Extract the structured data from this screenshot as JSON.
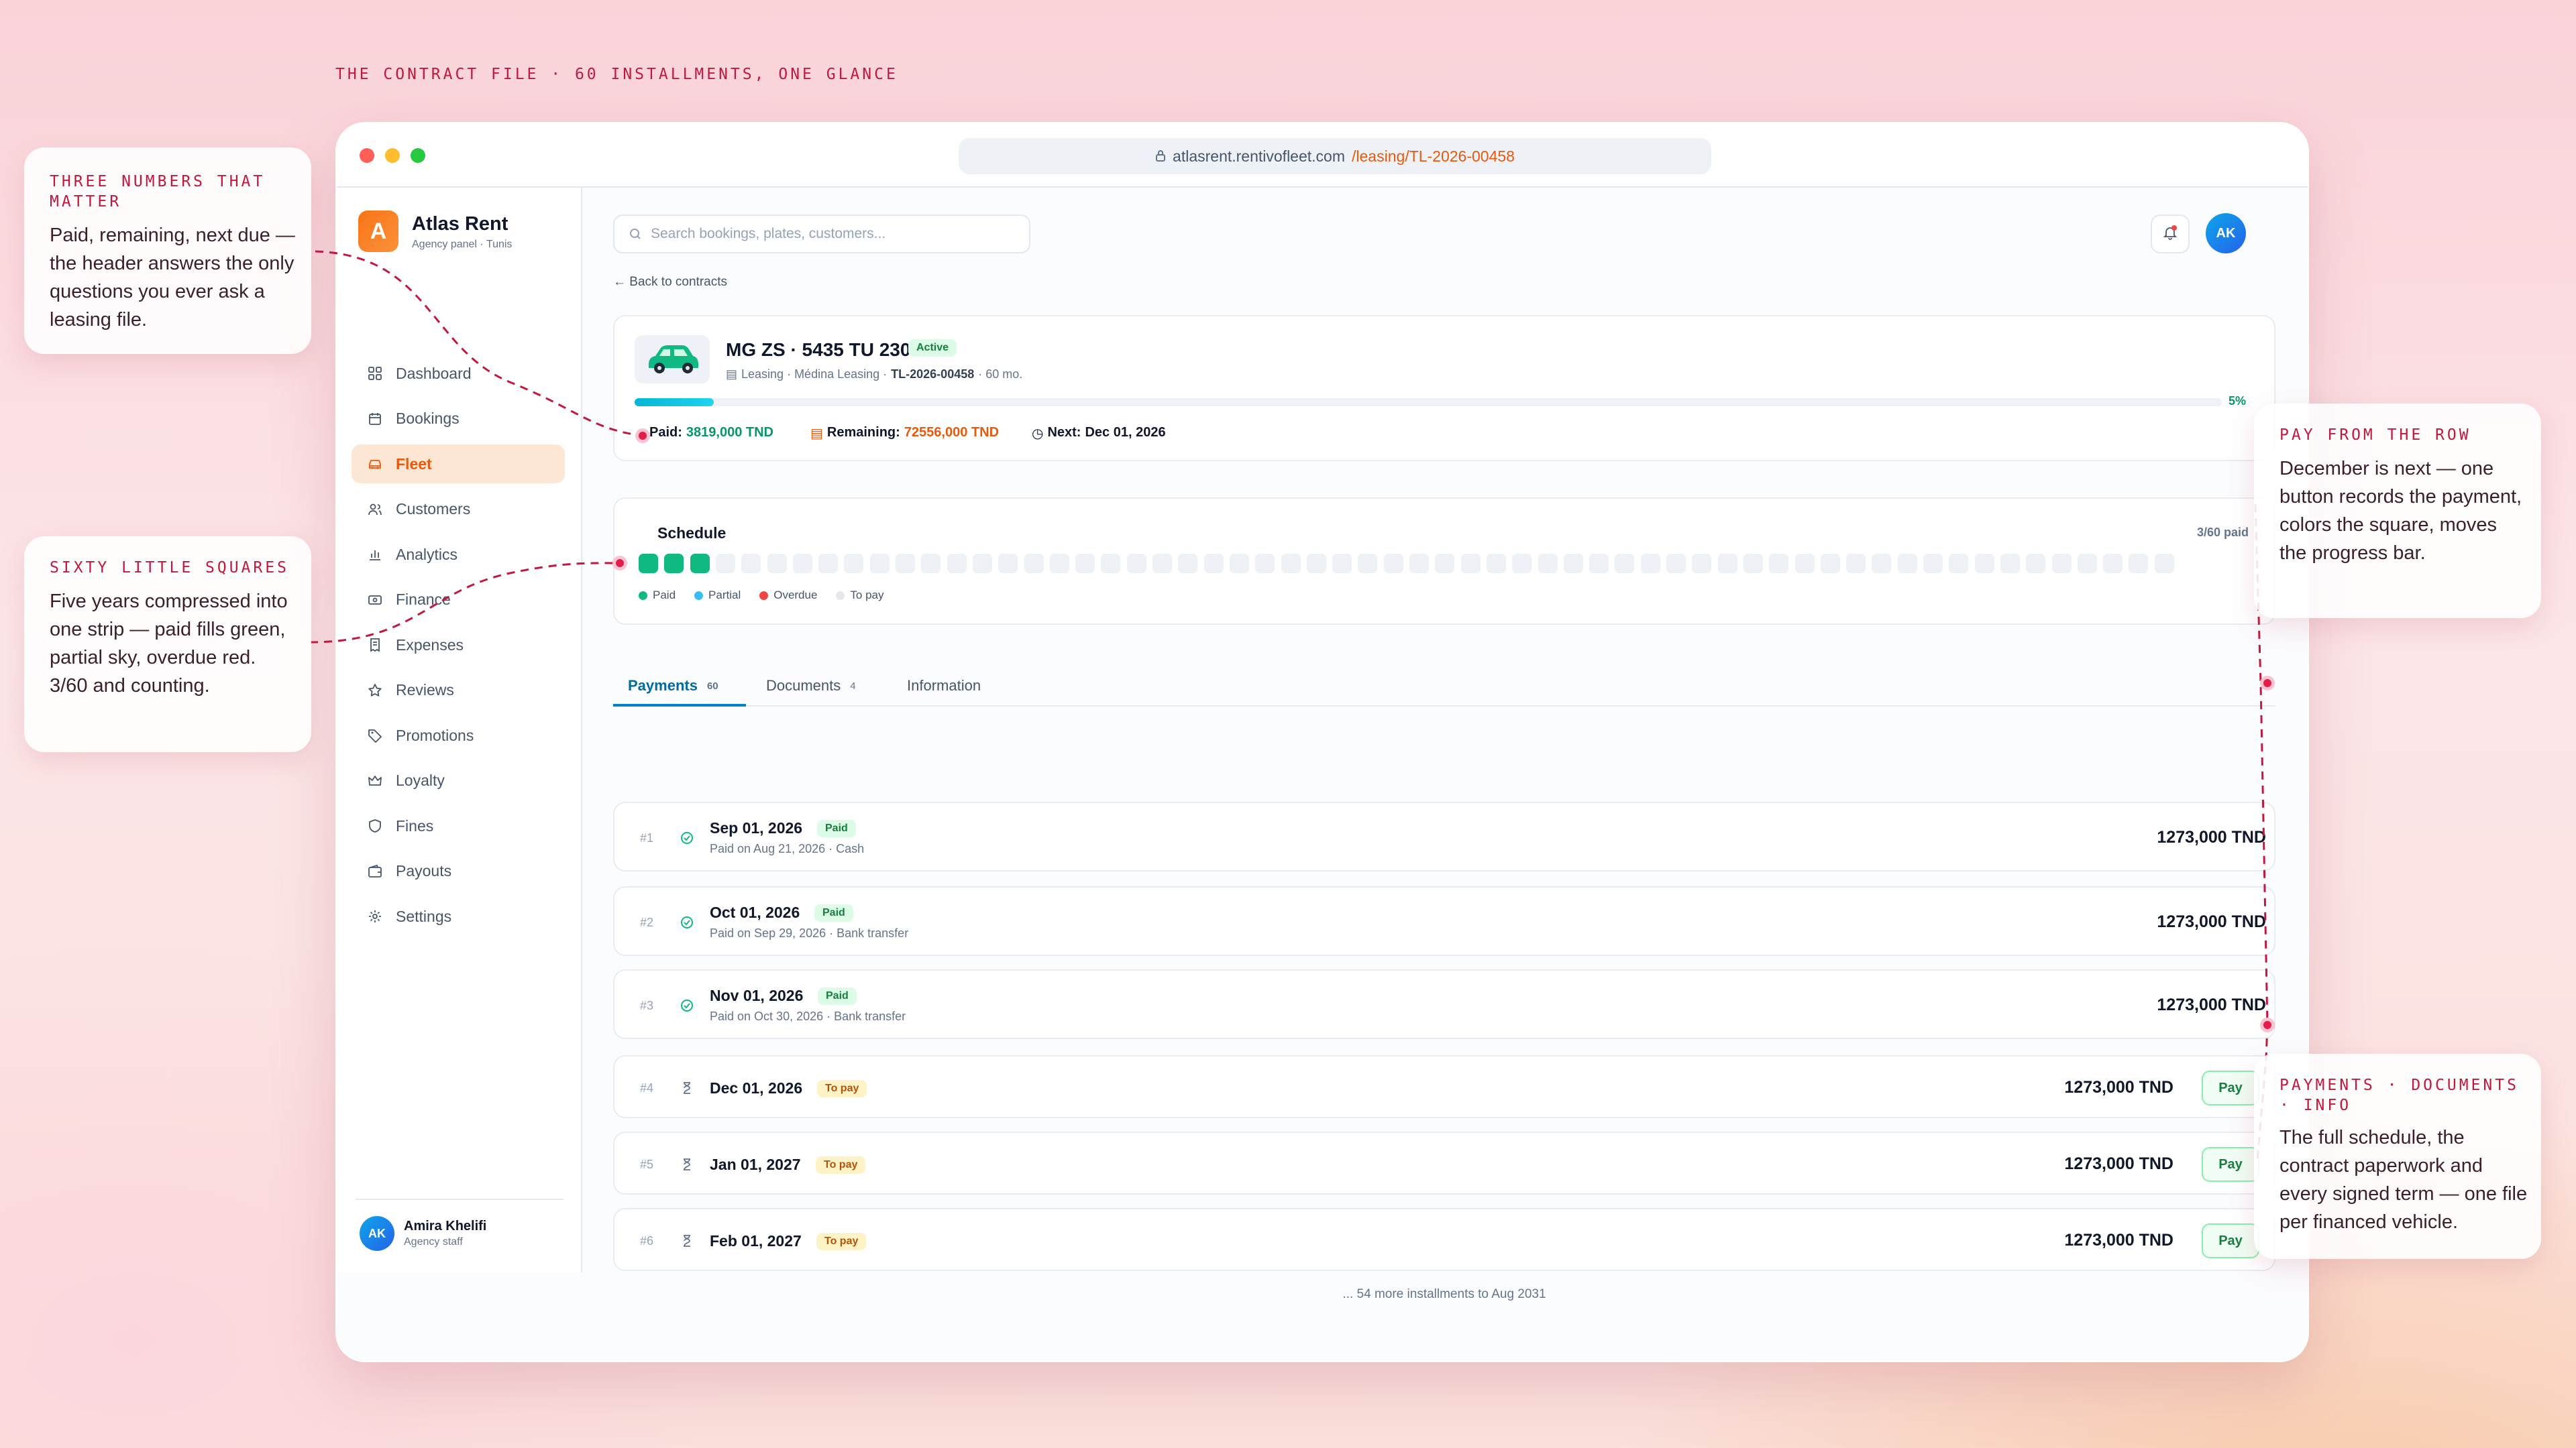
{
  "tagline": "THE CONTRACT FILE · 60 INSTALLMENTS, ONE GLANCE",
  "browser": {
    "host": "atlasrent.rentivofleet.com",
    "path": "/leasing/TL-2026-00458"
  },
  "sidebar": {
    "logo": "A",
    "brand": "Atlas Rent",
    "sub": "Agency panel · Tunis",
    "items": [
      {
        "label": "Dashboard",
        "icon": "grid-icon"
      },
      {
        "label": "Bookings",
        "icon": "calendar-icon"
      },
      {
        "label": "Fleet",
        "icon": "car-icon"
      },
      {
        "label": "Customers",
        "icon": "users-icon"
      },
      {
        "label": "Analytics",
        "icon": "bar-chart-icon"
      },
      {
        "label": "Finance",
        "icon": "banknote-icon"
      },
      {
        "label": "Expenses",
        "icon": "receipt-icon"
      },
      {
        "label": "Reviews",
        "icon": "star-icon"
      },
      {
        "label": "Promotions",
        "icon": "tag-icon"
      },
      {
        "label": "Loyalty",
        "icon": "crown-icon"
      },
      {
        "label": "Fines",
        "icon": "shield-icon"
      },
      {
        "label": "Payouts",
        "icon": "wallet-icon"
      },
      {
        "label": "Settings",
        "icon": "gear-icon"
      }
    ],
    "user": {
      "initials": "AK",
      "name": "Amira Khelifi",
      "role": "Agency staff"
    }
  },
  "header": {
    "search_placeholder": "Search bookings, plates, customers...",
    "avatar": "AK"
  },
  "back": "← Back to contracts",
  "contract": {
    "title": "MG ZS · 5435 TU 230",
    "status": "Active",
    "meta_prefix": "Leasing · Médina Leasing ·",
    "ref": "TL-2026-00458",
    "meta_suffix": "· 60 mo.",
    "progress_pct": "5%",
    "progress_value": 0.05,
    "paid_label": "Paid:",
    "paid": "3819,000 TND",
    "remaining_label": "Remaining:",
    "remaining": "72556,000 TND",
    "next_label": "Next:",
    "next": "Dec 01, 2026"
  },
  "schedule": {
    "title": "Schedule",
    "count": "3/60 paid",
    "total": 60,
    "paid": 3,
    "legend": [
      "Paid",
      "Partial",
      "Overdue",
      "To pay"
    ],
    "colors": {
      "paid": "#10b981",
      "partial": "#38bdf8",
      "overdue": "#ef4444",
      "todo": "#e5e7eb"
    }
  },
  "tabs": [
    {
      "label": "Payments",
      "count": "60"
    },
    {
      "label": "Documents",
      "count": "4"
    },
    {
      "label": "Information",
      "count": ""
    }
  ],
  "payments": [
    {
      "n": "#1",
      "date": "Sep 01, 2026",
      "status": "Paid",
      "detail": "Paid on Aug 21, 2026 · Cash",
      "amount": "1273,000 TND"
    },
    {
      "n": "#2",
      "date": "Oct 01, 2026",
      "status": "Paid",
      "detail": "Paid on Sep 29, 2026 · Bank transfer",
      "amount": "1273,000 TND"
    },
    {
      "n": "#3",
      "date": "Nov 01, 2026",
      "status": "Paid",
      "detail": "Paid on Oct 30, 2026 · Bank transfer",
      "amount": "1273,000 TND"
    },
    {
      "n": "#4",
      "date": "Dec 01, 2026",
      "status": "To pay",
      "detail": "",
      "amount": "1273,000 TND",
      "action": "Pay"
    },
    {
      "n": "#5",
      "date": "Jan 01, 2027",
      "status": "To pay",
      "detail": "",
      "amount": "1273,000 TND",
      "action": "Pay"
    },
    {
      "n": "#6",
      "date": "Feb 01, 2027",
      "status": "To pay",
      "detail": "",
      "amount": "1273,000 TND",
      "action": "Pay"
    }
  ],
  "more": "... 54 more installments to Aug 2031",
  "callouts": {
    "numbers": {
      "title": "THREE NUMBERS THAT MATTER",
      "body": "Paid, remaining, next due — the header answers the only questions you ever ask a leasing file."
    },
    "squares": {
      "title": "SIXTY LITTLE SQUARES",
      "body": "Five years compressed into one strip — paid fills green, partial sky, overdue red. 3/60 and counting."
    },
    "pay": {
      "title": "PAY FROM THE ROW",
      "body": "December is next — one button records the payment, colors the square, moves the progress bar."
    },
    "tabs": {
      "title": "PAYMENTS · DOCUMENTS · INFO",
      "body": "The full schedule, the contract paperwork and every signed term — one file per financed vehicle."
    }
  }
}
